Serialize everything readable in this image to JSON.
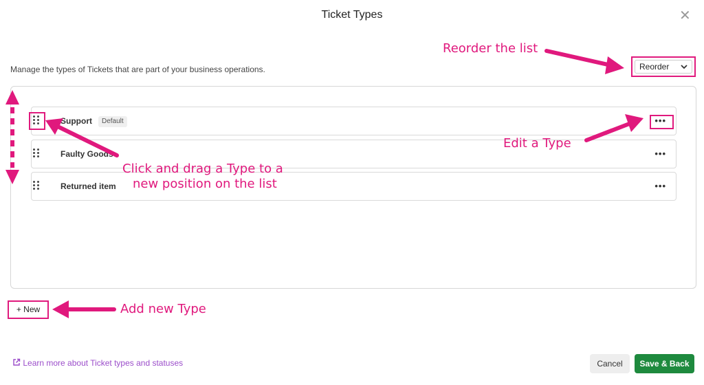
{
  "dialog": {
    "title": "Ticket Types",
    "description": "Manage the types of Tickets that are part of your business operations."
  },
  "reorder": {
    "label": "Reorder"
  },
  "types": [
    {
      "label": "Support",
      "badge": "Default"
    },
    {
      "label": "Faulty Goods"
    },
    {
      "label": "Returned item"
    }
  ],
  "new_button": {
    "label": "+ New"
  },
  "footer": {
    "learn_more": "Learn more about Ticket types and statuses",
    "cancel": "Cancel",
    "save": "Save & Back"
  },
  "annotations": {
    "reorder": "Reorder the list",
    "edit": "Edit a Type",
    "drag_line1": "Click and drag a Type to a",
    "drag_line2": "new position on the list",
    "add": "Add new Type"
  },
  "colors": {
    "accent": "#e0197d",
    "save": "#1e8a3e",
    "link": "#9b4dca"
  },
  "icons": {
    "close": "close-icon",
    "chevron": "chevron-down-icon",
    "grip": "drag-handle-icon",
    "more": "more-icon",
    "external": "external-link-icon"
  }
}
